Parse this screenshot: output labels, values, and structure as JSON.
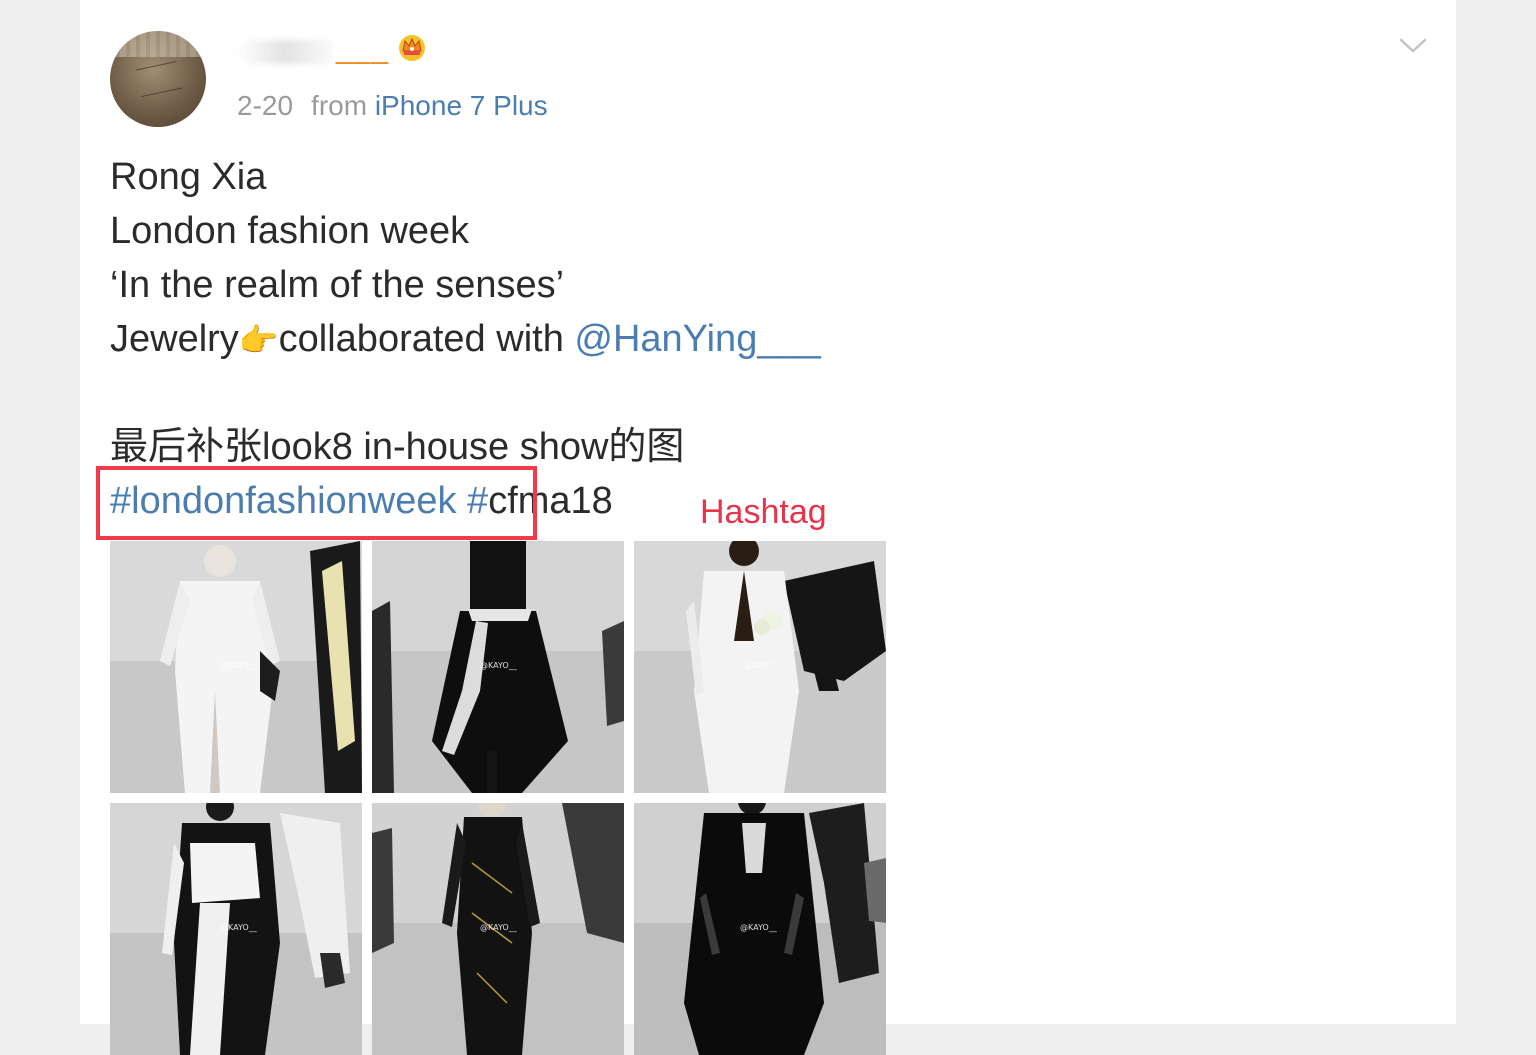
{
  "post": {
    "username_suffix": "___",
    "date": "2-20",
    "from_label": "from",
    "device": "iPhone 7 Plus",
    "lines": [
      "Rong Xia",
      "London fashion week",
      "‘In the realm of the senses’"
    ],
    "jewelry_prefix": "Jewelry",
    "jewelry_emoji": "👉",
    "jewelry_suffix": "collaborated with ",
    "mention": "@HanYing___",
    "chinese_line": "最后补张look8 in-house show的图",
    "hashtag": "#londonfashionweek #",
    "after_hashtag": "cfma18"
  },
  "annotation": {
    "label": "Hashtag",
    "color": "#f03c4a"
  },
  "photos": [
    {
      "watermark": "@KAYO__"
    },
    {
      "watermark": "@KAYO__"
    },
    {
      "watermark": "@KAYO__"
    },
    {
      "watermark": "@KAYO__"
    },
    {
      "watermark": "@KAYO__"
    },
    {
      "watermark": "@KAYO__"
    }
  ],
  "colors": {
    "link": "#4b7db0",
    "username_accent": "#f08a1a",
    "meta_gray": "#9a9a9a"
  },
  "icons": {
    "crown": "crown-icon",
    "chevron": "chevron-down-icon"
  }
}
